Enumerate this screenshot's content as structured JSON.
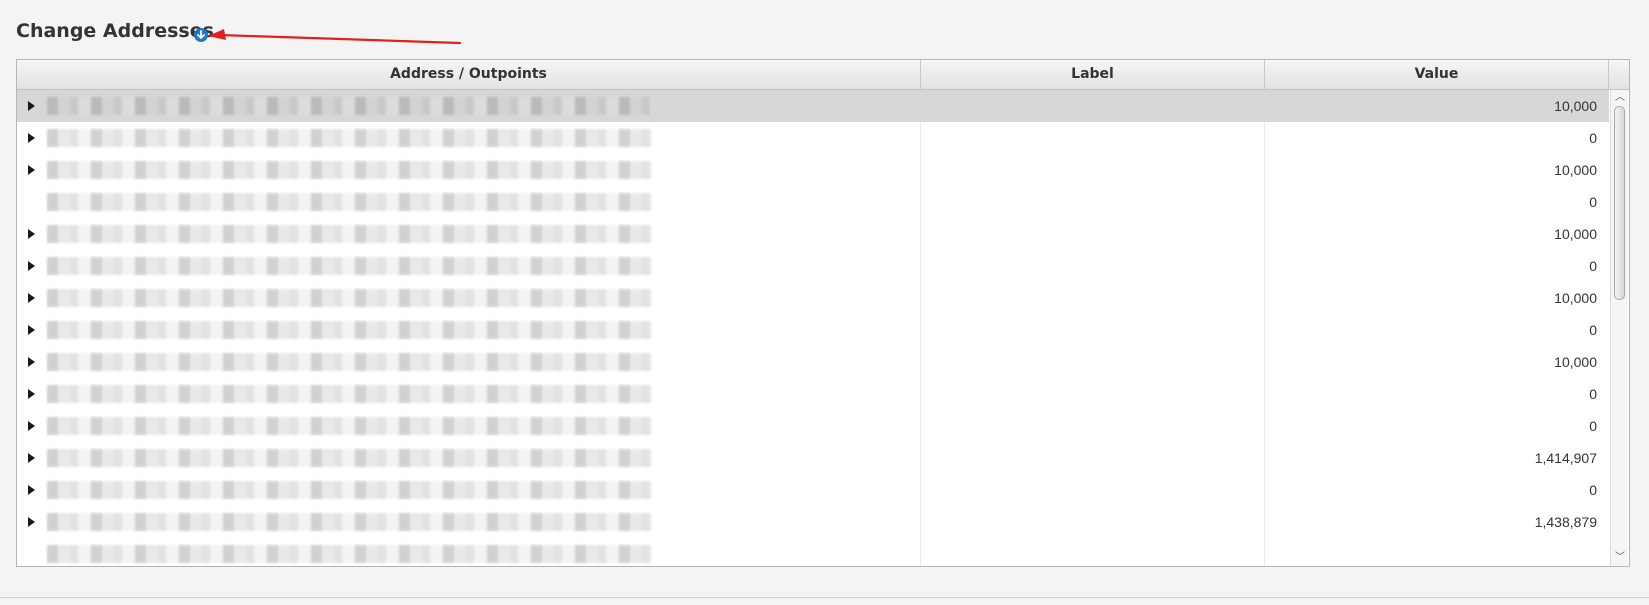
{
  "section": {
    "title": "Change Addresses",
    "icon": "info-circle-down-icon",
    "accent_color": "#1f78c8",
    "annotation_color": "#e02020"
  },
  "table": {
    "columns": [
      "Address / Outpoints",
      "Label",
      "Value"
    ],
    "rows": [
      {
        "expandable": true,
        "selected": true,
        "label": "",
        "value": "10,000"
      },
      {
        "expandable": true,
        "selected": false,
        "label": "",
        "value": "0"
      },
      {
        "expandable": true,
        "selected": false,
        "label": "",
        "value": "10,000"
      },
      {
        "expandable": false,
        "selected": false,
        "label": "",
        "value": "0"
      },
      {
        "expandable": true,
        "selected": false,
        "label": "",
        "value": "10,000"
      },
      {
        "expandable": true,
        "selected": false,
        "label": "",
        "value": "0"
      },
      {
        "expandable": true,
        "selected": false,
        "label": "",
        "value": "10,000"
      },
      {
        "expandable": true,
        "selected": false,
        "label": "",
        "value": "0"
      },
      {
        "expandable": true,
        "selected": false,
        "label": "",
        "value": "10,000"
      },
      {
        "expandable": true,
        "selected": false,
        "label": "",
        "value": "0"
      },
      {
        "expandable": true,
        "selected": false,
        "label": "",
        "value": "0"
      },
      {
        "expandable": true,
        "selected": false,
        "label": "",
        "value": "1,414,907"
      },
      {
        "expandable": true,
        "selected": false,
        "label": "",
        "value": "0"
      },
      {
        "expandable": true,
        "selected": false,
        "label": "",
        "value": "1,438,879"
      },
      {
        "expandable": false,
        "selected": false,
        "label": "",
        "value": ""
      }
    ]
  },
  "scrollbar": {
    "up_icon": "scroll-up-arrow-icon",
    "down_icon": "scroll-down-arrow-icon"
  }
}
